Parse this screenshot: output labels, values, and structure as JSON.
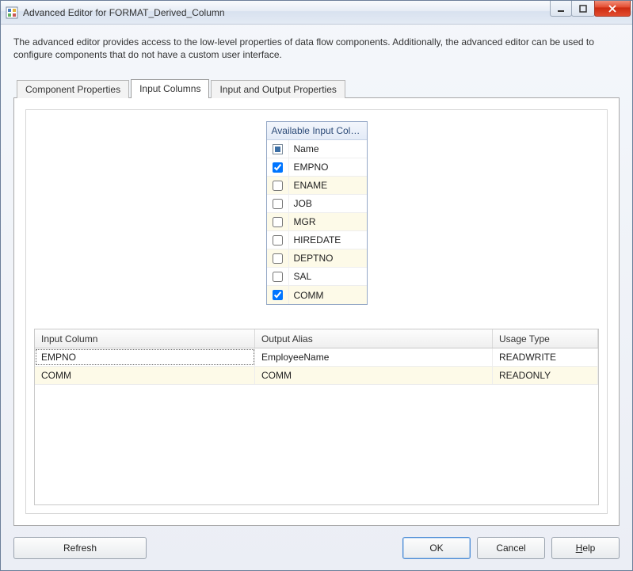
{
  "window": {
    "title": "Advanced Editor for FORMAT_Derived_Column"
  },
  "description": "The advanced editor provides access to the low-level properties of data flow components. Additionally, the advanced editor can be used to configure components that do not have a custom user interface.",
  "tabs": {
    "component_properties": "Component Properties",
    "input_columns": "Input Columns",
    "input_output_properties": "Input and Output Properties"
  },
  "available_columns": {
    "header": "Available Input Colu...",
    "name_header": "Name",
    "rows": [
      {
        "label": "EMPNO",
        "checked": true
      },
      {
        "label": "ENAME",
        "checked": false
      },
      {
        "label": "JOB",
        "checked": false
      },
      {
        "label": "MGR",
        "checked": false
      },
      {
        "label": "HIREDATE",
        "checked": false
      },
      {
        "label": "DEPTNO",
        "checked": false
      },
      {
        "label": "SAL",
        "checked": false
      },
      {
        "label": "COMM",
        "checked": true
      }
    ]
  },
  "grid": {
    "headers": {
      "input_column": "Input Column",
      "output_alias": "Output Alias",
      "usage_type": "Usage Type"
    },
    "rows": [
      {
        "input": "EMPNO",
        "alias": "EmployeeName",
        "usage": "READWRITE"
      },
      {
        "input": "COMM",
        "alias": "COMM",
        "usage": "READONLY"
      }
    ]
  },
  "buttons": {
    "refresh": "Refresh",
    "ok": "OK",
    "cancel": "Cancel",
    "help": "Help"
  }
}
